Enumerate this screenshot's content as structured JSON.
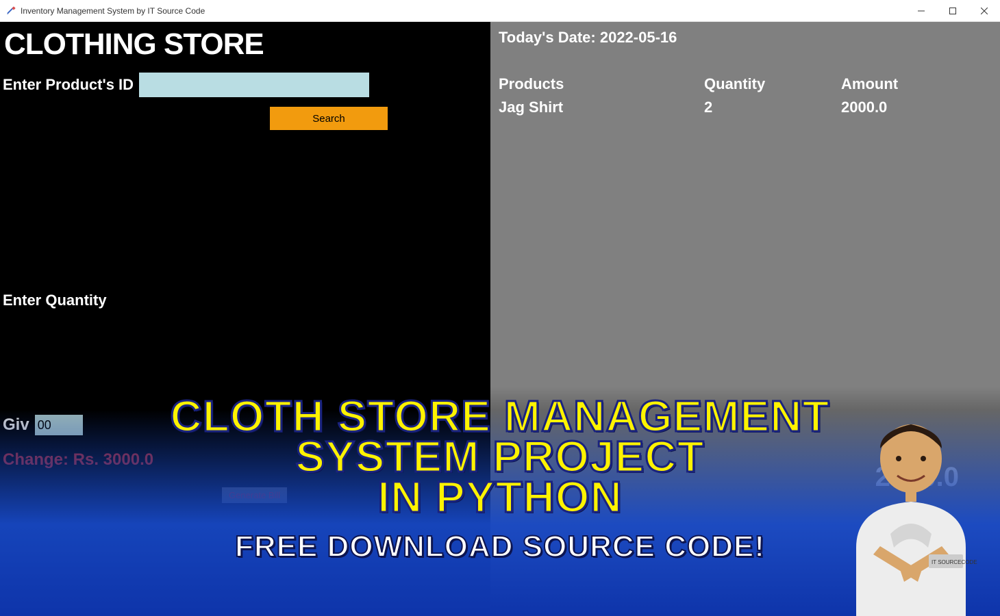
{
  "window": {
    "title": "Inventory Management System by IT Source Code"
  },
  "left": {
    "store_title": "CLOTHING STORE",
    "product_id_label": "Enter Product's ID",
    "product_id_value": "",
    "search_label": "Search",
    "quantity_label": "Enter Quantity",
    "given_amount_label": "Giv",
    "given_amount_value": "00",
    "change_label": "Change: Rs. 3000.0",
    "generate_bill_label": "Generate Bill"
  },
  "right": {
    "date_label": "Today's Date: 2022-05-16",
    "headers": {
      "products": "Products",
      "quantity": "Quantity",
      "amount": "Amount"
    },
    "rows": [
      {
        "product": "Jag Shirt",
        "quantity": "2",
        "amount": "2000.0"
      }
    ],
    "total_label": "2000.0"
  },
  "overlay": {
    "line1": "CLOTH STORE MANAGEMENT",
    "line2": "SYSTEM PROJECT",
    "line3": "IN PYTHON",
    "sub": "FREE DOWNLOAD SOURCE CODE!"
  }
}
